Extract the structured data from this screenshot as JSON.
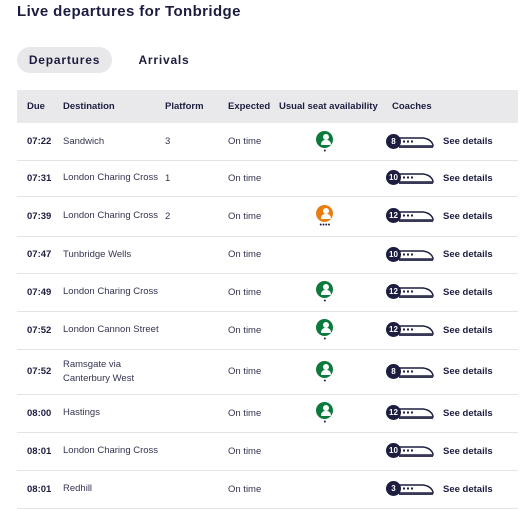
{
  "page": {
    "title": "Live departures for Tonbridge"
  },
  "tabs": [
    {
      "label": "Departures",
      "active": true
    },
    {
      "label": "Arrivals",
      "active": false
    }
  ],
  "table": {
    "headers": {
      "due": "Due",
      "destination": "Destination",
      "platform": "Platform",
      "expected": "Expected",
      "seat": "Usual seat availability",
      "coaches": "Coaches"
    },
    "rows": [
      {
        "due": "07:22",
        "destination": "Sandwich",
        "platform": "3",
        "expected": "On time",
        "seat": "green",
        "seat_dots": "•",
        "coaches": "8",
        "details": "See details"
      },
      {
        "due": "07:31",
        "destination": "London Charing Cross",
        "platform": "1",
        "expected": "On time",
        "seat": "",
        "seat_dots": "",
        "coaches": "10",
        "details": "See details"
      },
      {
        "due": "07:39",
        "destination": "London Charing Cross",
        "platform": "2",
        "expected": "On time",
        "seat": "orange",
        "seat_dots": "••••",
        "coaches": "12",
        "details": "See details"
      },
      {
        "due": "07:47",
        "destination": "Tunbridge Wells",
        "platform": "",
        "expected": "On time",
        "seat": "",
        "seat_dots": "",
        "coaches": "10",
        "details": "See details"
      },
      {
        "due": "07:49",
        "destination": "London Charing Cross",
        "platform": "",
        "expected": "On time",
        "seat": "green",
        "seat_dots": "•",
        "coaches": "12",
        "details": "See details"
      },
      {
        "due": "07:52",
        "destination": "London Cannon Street",
        "platform": "",
        "expected": "On time",
        "seat": "green",
        "seat_dots": "•",
        "coaches": "12",
        "details": "See details"
      },
      {
        "due": "07:52",
        "destination": "Ramsgate via Canterbury West",
        "platform": "",
        "expected": "On time",
        "seat": "green",
        "seat_dots": "•",
        "coaches": "8",
        "details": "See details"
      },
      {
        "due": "08:00",
        "destination": "Hastings",
        "platform": "",
        "expected": "On time",
        "seat": "green",
        "seat_dots": "•",
        "coaches": "12",
        "details": "See details"
      },
      {
        "due": "08:01",
        "destination": "London Charing Cross",
        "platform": "",
        "expected": "On time",
        "seat": "",
        "seat_dots": "",
        "coaches": "10",
        "details": "See details"
      },
      {
        "due": "08:01",
        "destination": "Redhill",
        "platform": "",
        "expected": "On time",
        "seat": "",
        "seat_dots": "",
        "coaches": "3",
        "details": "See details"
      }
    ]
  },
  "icons": {
    "seat": "seat-availability-icon",
    "train": "train-coach-icon"
  },
  "colors": {
    "text": "#1c1d3f",
    "header_bg": "#e9e9ec",
    "seat_low": "#0c7a3c",
    "seat_busy": "#e87e12",
    "badge": "#1c1d3f"
  }
}
